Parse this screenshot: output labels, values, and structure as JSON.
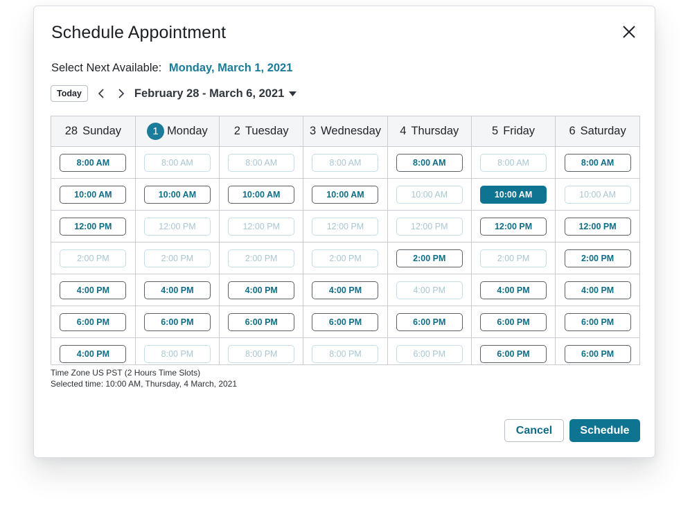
{
  "dialog": {
    "title": "Schedule Appointment",
    "next_available_label": "Select Next Available:",
    "next_available_date": "Monday, March 1, 2021"
  },
  "nav": {
    "today_label": "Today",
    "range_label": "February 28 - March 6, 2021"
  },
  "colors": {
    "accent": "#0f7491",
    "link": "#1a7c9a",
    "unavailable_text": "#a9c6d1"
  },
  "days": [
    {
      "num": "28",
      "name": "Sunday",
      "is_today": false
    },
    {
      "num": "1",
      "name": "Monday",
      "is_today": true
    },
    {
      "num": "2",
      "name": "Tuesday",
      "is_today": false
    },
    {
      "num": "3",
      "name": "Wednesday",
      "is_today": false
    },
    {
      "num": "4",
      "name": "Thursday",
      "is_today": false
    },
    {
      "num": "5",
      "name": "Friday",
      "is_today": false
    },
    {
      "num": "6",
      "name": "Saturday",
      "is_today": false
    }
  ],
  "slots": [
    [
      {
        "label": "8:00 AM",
        "state": "available"
      },
      {
        "label": "10:00 AM",
        "state": "available"
      },
      {
        "label": "12:00 PM",
        "state": "available"
      },
      {
        "label": "2:00 PM",
        "state": "unavailable"
      },
      {
        "label": "4:00 PM",
        "state": "available"
      },
      {
        "label": "6:00 PM",
        "state": "available"
      },
      {
        "label": "4:00 PM",
        "state": "available"
      }
    ],
    [
      {
        "label": "8:00 AM",
        "state": "unavailable"
      },
      {
        "label": "10:00 AM",
        "state": "available"
      },
      {
        "label": "12:00 PM",
        "state": "unavailable"
      },
      {
        "label": "2:00 PM",
        "state": "unavailable"
      },
      {
        "label": "4:00 PM",
        "state": "available"
      },
      {
        "label": "6:00 PM",
        "state": "available"
      },
      {
        "label": "8:00 PM",
        "state": "unavailable"
      }
    ],
    [
      {
        "label": "8:00 AM",
        "state": "unavailable"
      },
      {
        "label": "10:00 AM",
        "state": "available"
      },
      {
        "label": "12:00 PM",
        "state": "unavailable"
      },
      {
        "label": "2:00 PM",
        "state": "unavailable"
      },
      {
        "label": "4:00 PM",
        "state": "available"
      },
      {
        "label": "6:00 PM",
        "state": "available"
      },
      {
        "label": "8:00 PM",
        "state": "unavailable"
      }
    ],
    [
      {
        "label": "8:00 AM",
        "state": "unavailable"
      },
      {
        "label": "10:00 AM",
        "state": "available"
      },
      {
        "label": "12:00 PM",
        "state": "unavailable"
      },
      {
        "label": "2:00 PM",
        "state": "unavailable"
      },
      {
        "label": "4:00 PM",
        "state": "available"
      },
      {
        "label": "6:00 PM",
        "state": "available"
      },
      {
        "label": "8:00 PM",
        "state": "unavailable"
      }
    ],
    [
      {
        "label": "8:00 AM",
        "state": "available"
      },
      {
        "label": "10:00 AM",
        "state": "unavailable"
      },
      {
        "label": "12:00 PM",
        "state": "unavailable"
      },
      {
        "label": "2:00 PM",
        "state": "available"
      },
      {
        "label": "4:00 PM",
        "state": "unavailable"
      },
      {
        "label": "6:00 PM",
        "state": "available"
      },
      {
        "label": "6:00 PM",
        "state": "unavailable"
      }
    ],
    [
      {
        "label": "8:00 AM",
        "state": "unavailable"
      },
      {
        "label": "10:00 AM",
        "state": "selected"
      },
      {
        "label": "12:00 PM",
        "state": "available"
      },
      {
        "label": "2:00 PM",
        "state": "unavailable"
      },
      {
        "label": "4:00 PM",
        "state": "available"
      },
      {
        "label": "6:00 PM",
        "state": "available"
      },
      {
        "label": "6:00 PM",
        "state": "available"
      }
    ],
    [
      {
        "label": "8:00 AM",
        "state": "available"
      },
      {
        "label": "10:00 AM",
        "state": "unavailable"
      },
      {
        "label": "12:00 PM",
        "state": "available"
      },
      {
        "label": "2:00 PM",
        "state": "available"
      },
      {
        "label": "4:00 PM",
        "state": "available"
      },
      {
        "label": "6:00 PM",
        "state": "available"
      },
      {
        "label": "6:00 PM",
        "state": "available"
      }
    ]
  ],
  "footer": {
    "timezone_note": "Time Zone US PST (2 Hours Time Slots)",
    "selected_note": "Selected time: 10:00 AM, Thursday, 4 March, 2021",
    "cancel_label": "Cancel",
    "schedule_label": "Schedule"
  },
  "icons": {
    "close": "close-icon",
    "prev": "chevron-left-icon",
    "next": "chevron-right-icon",
    "dropdown": "caret-down-icon"
  }
}
